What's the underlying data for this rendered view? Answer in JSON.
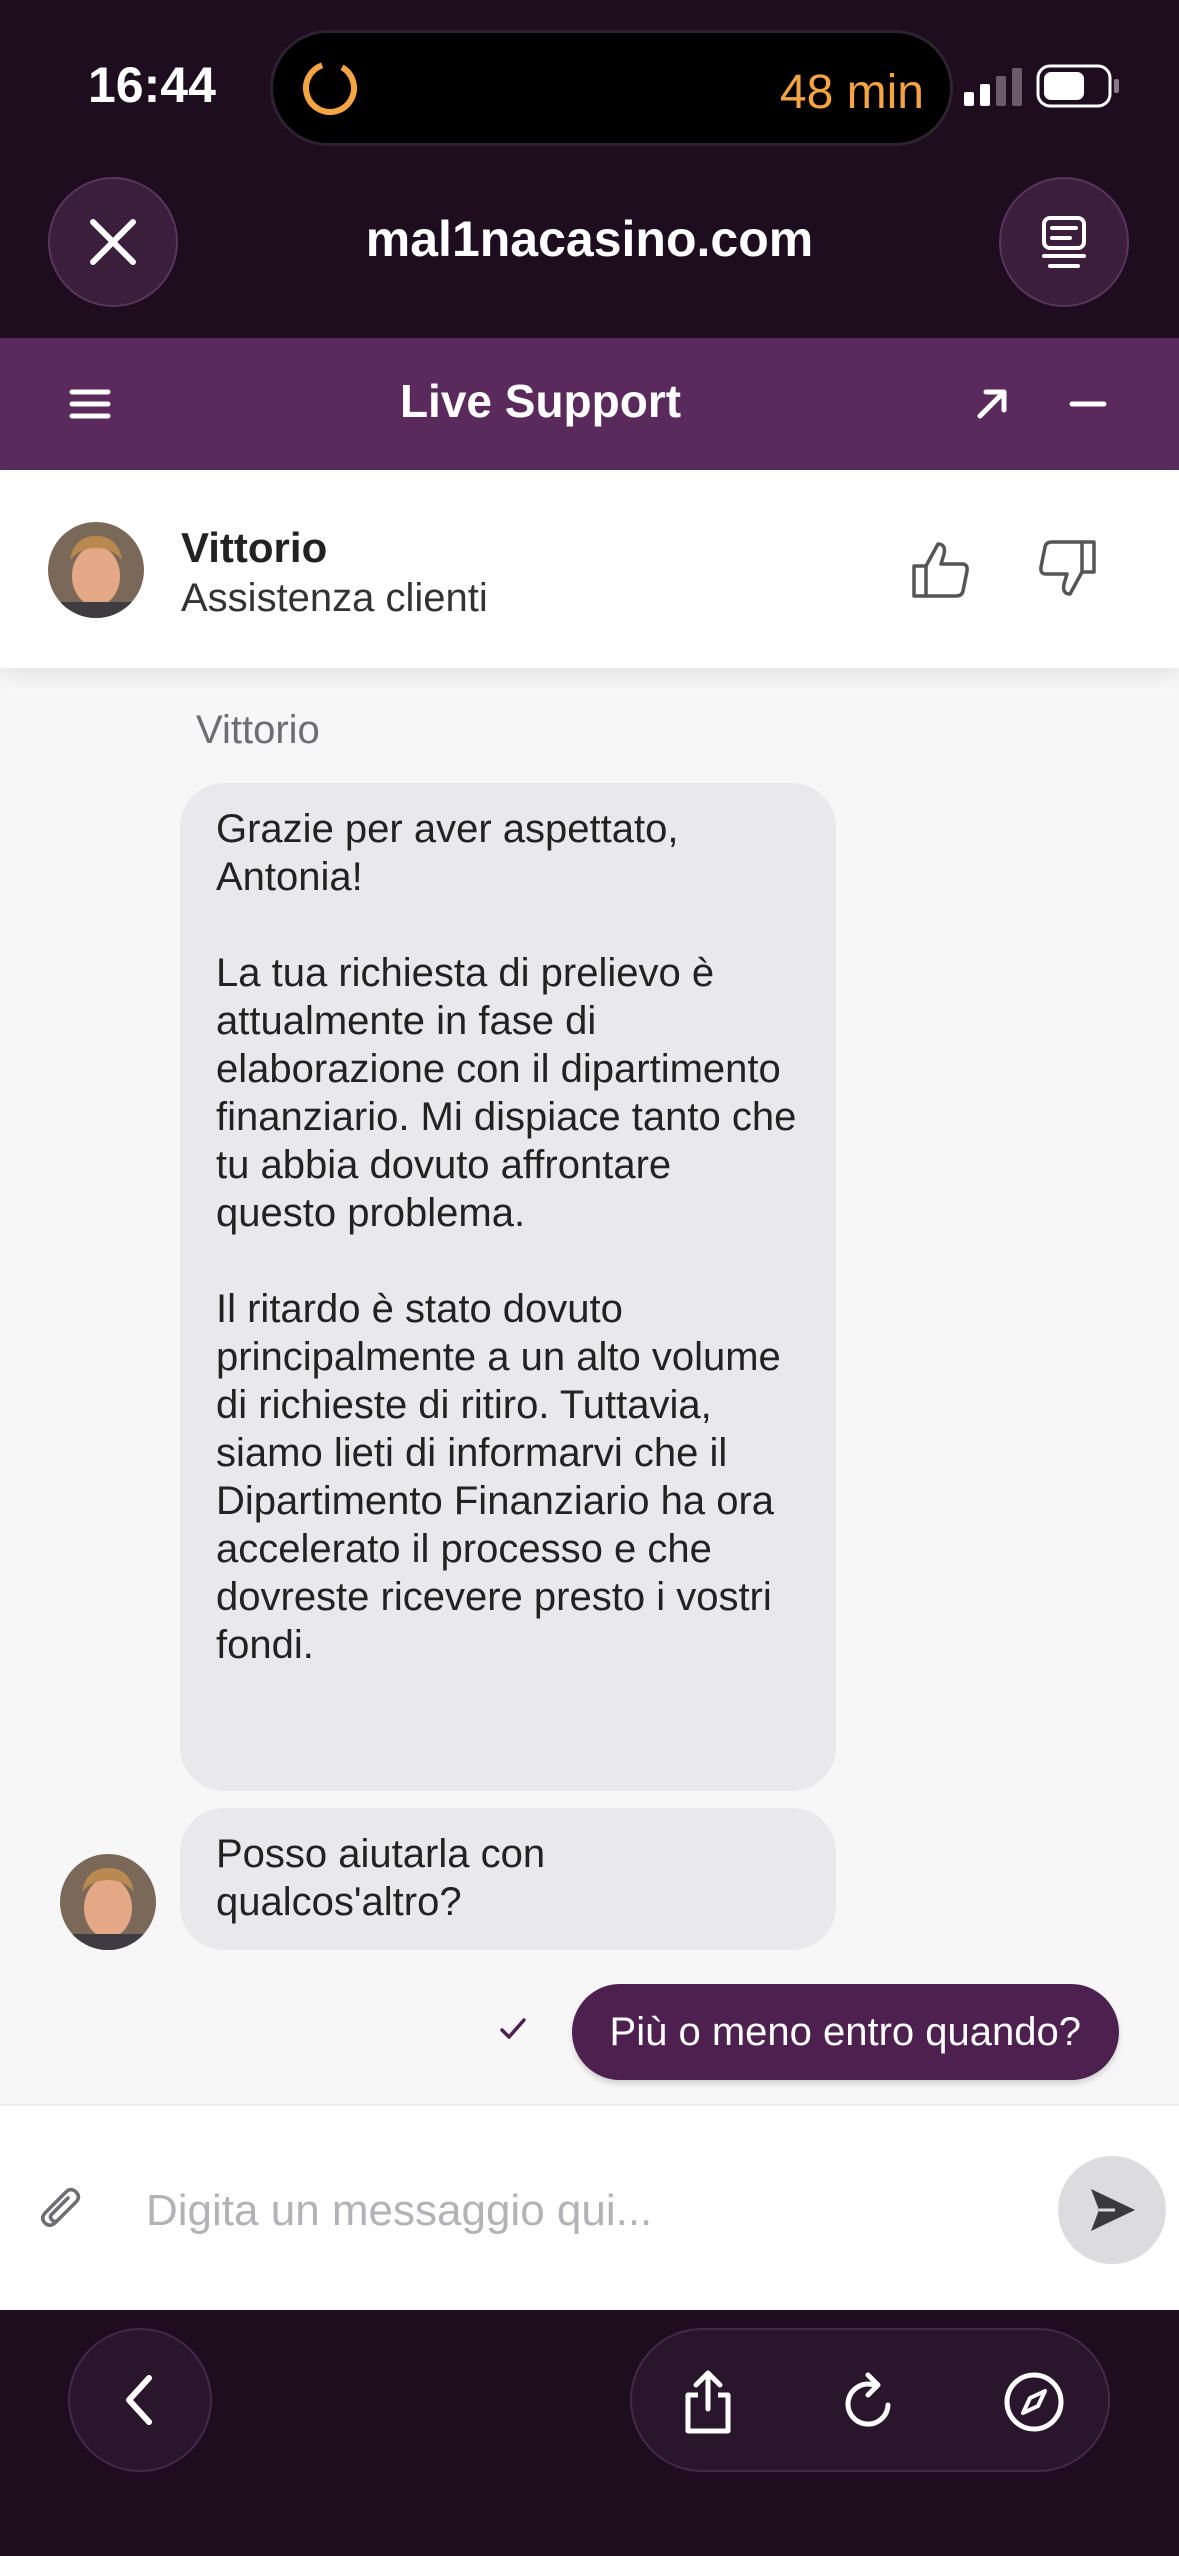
{
  "status_bar": {
    "time": "16:44",
    "timer": "48 min",
    "timer_color": "#f5a442"
  },
  "browser": {
    "url": "mal1nacasino.com",
    "close_icon": "close-icon",
    "reader_icon": "reader-mode-icon"
  },
  "support_bar": {
    "title": "Live Support",
    "background": "#5a2a5c"
  },
  "agent": {
    "name": "Vittorio",
    "role": "Assistenza clienti"
  },
  "chat": {
    "sender_label": "Vittorio",
    "messages": [
      {
        "from": "agent",
        "text": "Grazie per aver aspettato, Antonia!\n\nLa tua richiesta di prelievo è attualmente in fase di elaborazione con il dipartimento finanziario. Mi dispiace tanto che tu abbia dovuto affrontare questo problema.\n\nIl ritardo è stato dovuto principalmente a un alto volume di richieste di ritiro. Tuttavia, siamo lieti di informarvi che il Dipartimento Finanziario ha ora accelerato il processo e che dovreste ricevere presto i vostri fondi."
      },
      {
        "from": "agent",
        "text": "Posso aiutarla con qualcos'altro?"
      },
      {
        "from": "user",
        "text": "Più o meno entro quando?"
      }
    ],
    "user_bubble_color": "#4e2050"
  },
  "input": {
    "placeholder": "Digita un messaggio qui...",
    "value": ""
  }
}
